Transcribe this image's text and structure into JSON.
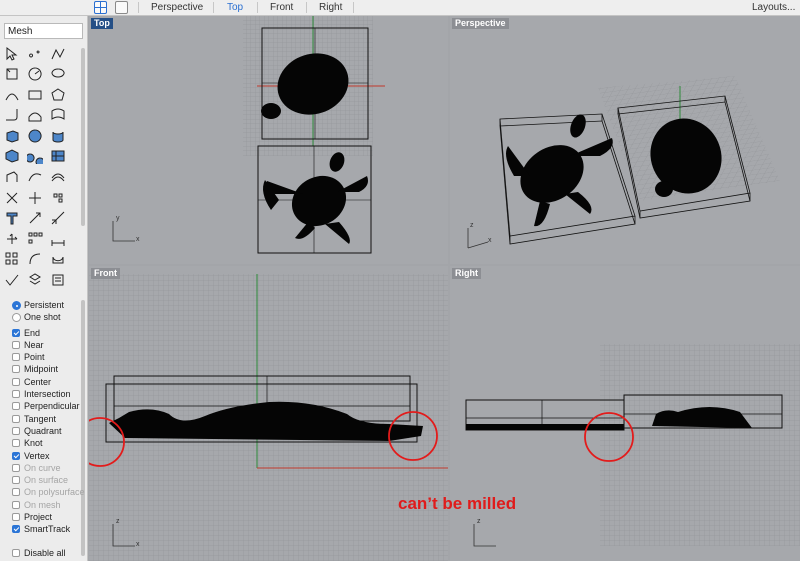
{
  "tabbar": {
    "tabs": [
      {
        "label": "Perspective",
        "active": false
      },
      {
        "label": "Top",
        "active": true
      },
      {
        "label": "Front",
        "active": false
      },
      {
        "label": "Right",
        "active": false
      }
    ],
    "layouts_label": "Layouts..."
  },
  "command": {
    "value": "Mesh"
  },
  "toolbar": {
    "tools": [
      "select-arrow-icon",
      "point-icon",
      "polyline-icon",
      "curve-edit-icon",
      "circle-icon",
      "ellipse-icon",
      "arc-icon",
      "rectangle-icon",
      "polygon-icon",
      "fillet-icon",
      "surface-edit-icon",
      "surface-from-curves-icon",
      "box-solid-icon",
      "sphere-icon",
      "cylinder-icon",
      "mesh-icon",
      "boolean-icon",
      "solid-edit-icon",
      "extrude-icon",
      "blend-icon",
      "offset-icon",
      "split-icon",
      "trim-icon",
      "explode-icon",
      "text-icon",
      "transform-icon",
      "scale-icon",
      "gumball-icon",
      "array-icon",
      "dimension-icon",
      "grid-array-icon",
      "bend-icon",
      "render-icon",
      "analyze-check-icon",
      "layer-icon",
      "properties-icon"
    ]
  },
  "osnap": {
    "modes": [
      {
        "label": "Persistent",
        "selected": true
      },
      {
        "label": "One shot",
        "selected": false
      }
    ],
    "items": [
      {
        "label": "End",
        "checked": true,
        "enabled": true
      },
      {
        "label": "Near",
        "checked": false,
        "enabled": true
      },
      {
        "label": "Point",
        "checked": false,
        "enabled": true
      },
      {
        "label": "Midpoint",
        "checked": false,
        "enabled": true
      },
      {
        "label": "Center",
        "checked": false,
        "enabled": true
      },
      {
        "label": "Intersection",
        "checked": false,
        "enabled": true
      },
      {
        "label": "Perpendicular",
        "checked": false,
        "enabled": true
      },
      {
        "label": "Tangent",
        "checked": false,
        "enabled": true
      },
      {
        "label": "Quadrant",
        "checked": false,
        "enabled": true
      },
      {
        "label": "Knot",
        "checked": false,
        "enabled": true
      },
      {
        "label": "Vertex",
        "checked": true,
        "enabled": true
      },
      {
        "label": "On curve",
        "checked": false,
        "enabled": false
      },
      {
        "label": "On surface",
        "checked": false,
        "enabled": false
      },
      {
        "label": "On polysurface",
        "checked": false,
        "enabled": false
      },
      {
        "label": "On mesh",
        "checked": false,
        "enabled": false
      },
      {
        "label": "Project",
        "checked": false,
        "enabled": true
      },
      {
        "label": "SmartTrack",
        "checked": true,
        "enabled": true
      }
    ],
    "disable_all": {
      "label": "Disable all",
      "checked": false
    }
  },
  "viewports": {
    "top": {
      "title": "Top",
      "active": true
    },
    "perspective": {
      "title": "Perspective",
      "active": false
    },
    "front": {
      "title": "Front",
      "active": false
    },
    "right": {
      "title": "Right",
      "active": false
    },
    "axis_labels": {
      "x": "x",
      "y": "y",
      "z": "z"
    }
  },
  "annotation": {
    "text": "can’t be milled",
    "color": "#e01b1b"
  },
  "colors": {
    "viewport_bg": "#a6a8ac",
    "active_title": "#254f86",
    "accent": "#2b75d6",
    "x_axis": "#c0392b",
    "y_axis": "#2d8a3a"
  }
}
